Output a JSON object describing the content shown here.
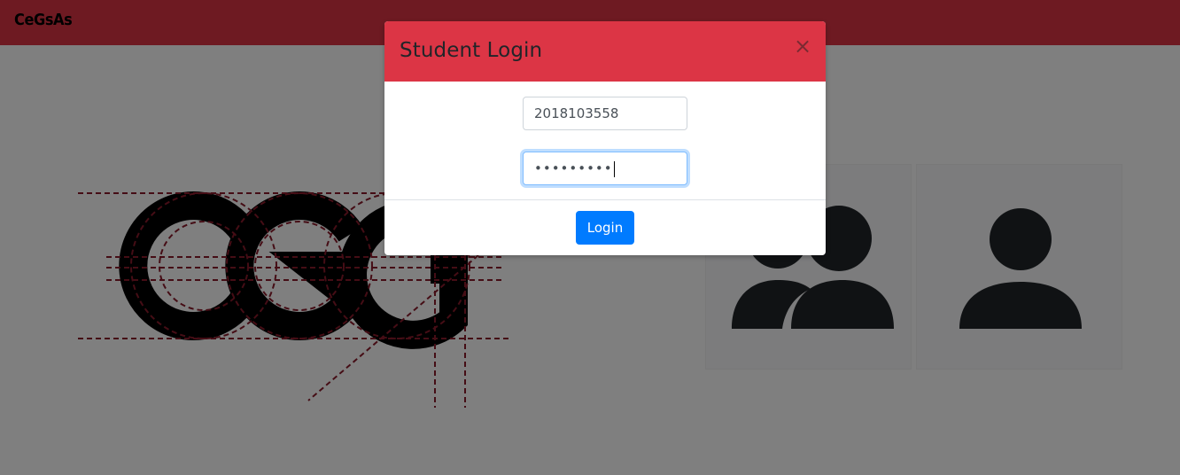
{
  "navbar": {
    "brand": "CeGsAs",
    "color": "#dc3545"
  },
  "logo": {
    "letters": "CEG",
    "icon": "ceg-construction-logo"
  },
  "role_cards": [
    {
      "icon": "users-group-icon"
    },
    {
      "icon": "user-icon"
    }
  ],
  "modal": {
    "title": "Student Login",
    "close_label": "×",
    "header_color": "#dc3545",
    "student_id": {
      "value": "2018103558"
    },
    "password": {
      "masked_value": "•••••••••"
    },
    "login_button": "Login",
    "accent": "#007bff"
  }
}
